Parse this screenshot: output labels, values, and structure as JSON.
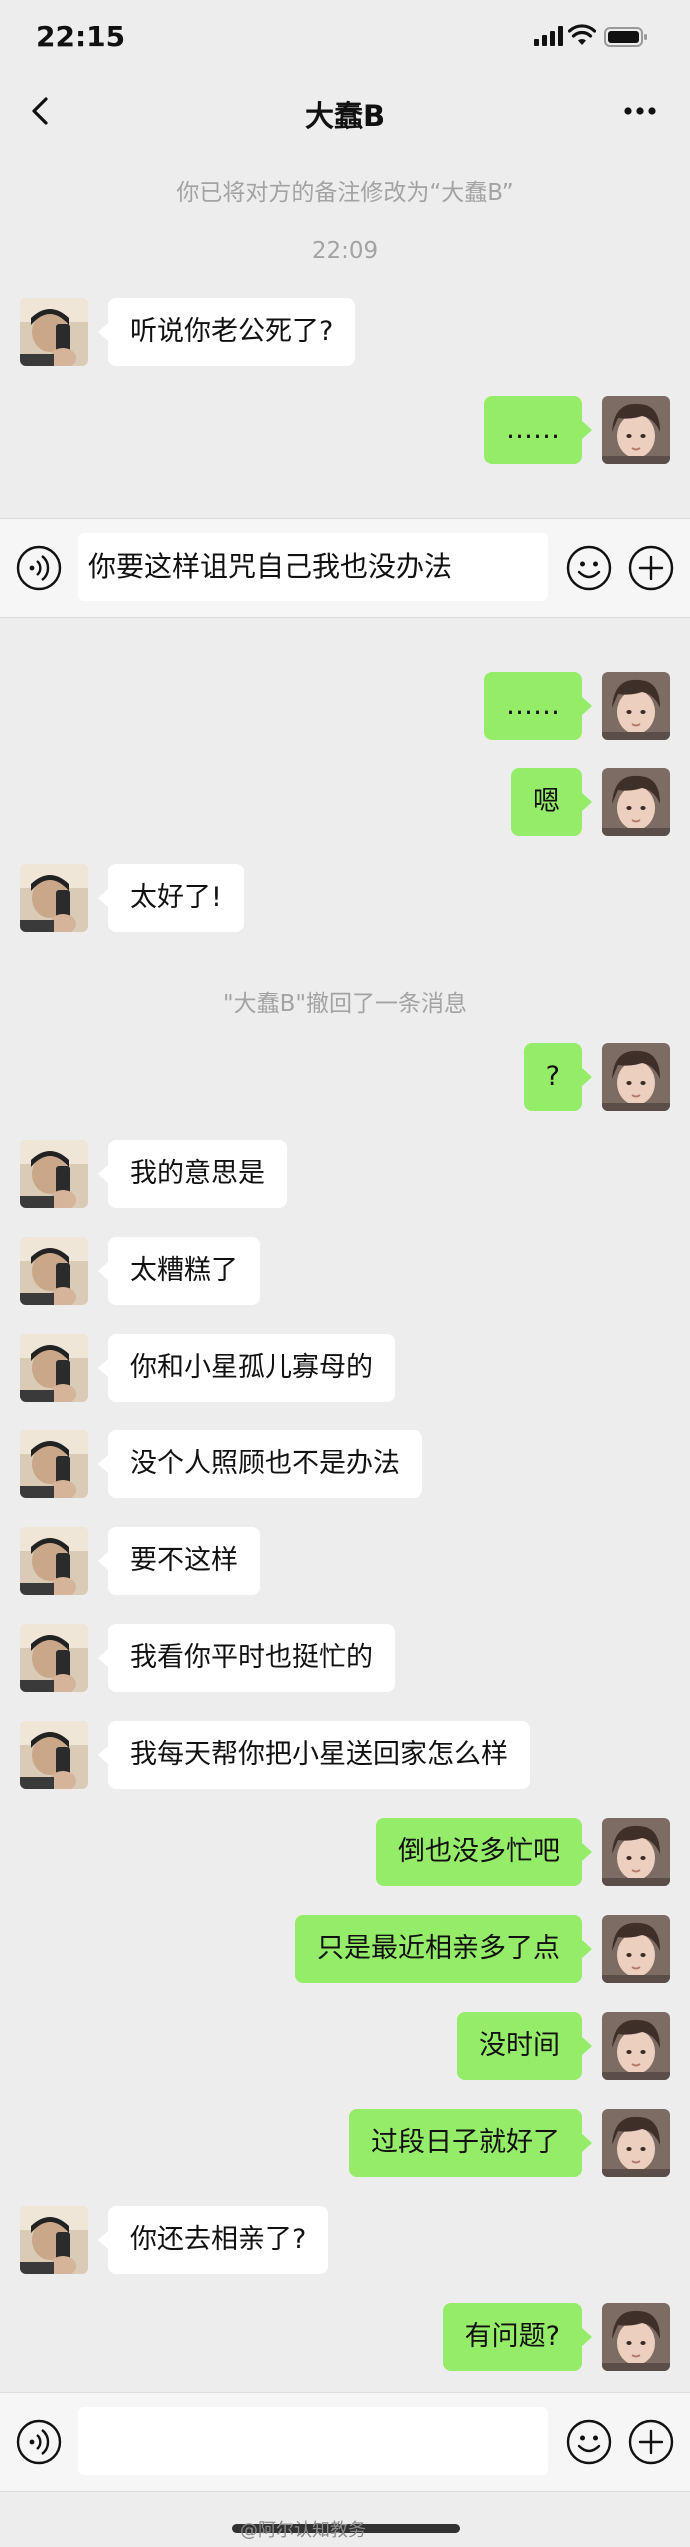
{
  "status_bar": {
    "time": "22:15"
  },
  "nav": {
    "title": "大蠢B"
  },
  "system": {
    "remark_notice": "你已将对方的备注修改为“大蠢B”",
    "timestamp": "22:09",
    "recall_notice": "\"大蠢B\"撤回了一条消息"
  },
  "messages": [
    {
      "side": "in",
      "text": "听说你老公死了?"
    },
    {
      "side": "out",
      "text": "……"
    },
    {
      "side": "out",
      "text": "……"
    },
    {
      "side": "out",
      "text": "嗯"
    },
    {
      "side": "in",
      "text": "太好了!"
    },
    {
      "side": "out",
      "text": "?"
    },
    {
      "side": "in",
      "text": "我的意思是"
    },
    {
      "side": "in",
      "text": "太糟糕了"
    },
    {
      "side": "in",
      "text": "你和小星孤儿寡母的"
    },
    {
      "side": "in",
      "text": "没个人照顾也不是办法"
    },
    {
      "side": "in",
      "text": "要不这样"
    },
    {
      "side": "in",
      "text": "我看你平时也挺忙的"
    },
    {
      "side": "in",
      "text": "我每天帮你把小星送回家怎么样"
    },
    {
      "side": "out",
      "text": "倒也没多忙吧"
    },
    {
      "side": "out",
      "text": "只是最近相亲多了点"
    },
    {
      "side": "out",
      "text": "没时间"
    },
    {
      "side": "out",
      "text": "过段日子就好了"
    },
    {
      "side": "in",
      "text": "你还去相亲了?"
    },
    {
      "side": "out",
      "text": "有问题?"
    }
  ],
  "composer_mid": {
    "text": "你要这样诅咒自己我也没办法"
  },
  "composer_bottom": {
    "text": ""
  },
  "watermark": "@阿尔认知教务",
  "icons": [
    "back-icon",
    "more-icon",
    "signal-icon",
    "wifi-icon",
    "battery-icon",
    "voice-icon",
    "emoji-icon",
    "plus-icon"
  ],
  "colors": {
    "background": "#ededed",
    "bubble_out": "#95ec69",
    "bubble_in": "#ffffff",
    "system_text": "#a3a3a3"
  }
}
